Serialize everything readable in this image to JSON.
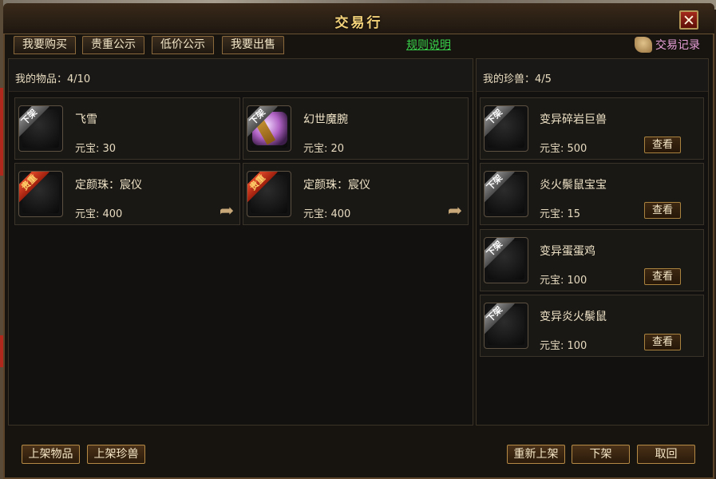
{
  "window": {
    "title": "交易行",
    "close_label": "✕"
  },
  "tabs": [
    {
      "label": "我要购买"
    },
    {
      "label": "贵重公示"
    },
    {
      "label": "低价公示"
    },
    {
      "label": "我要出售"
    }
  ],
  "rules_link": "规则说明",
  "trade_record": "交易记录",
  "items_panel": {
    "label": "我的物品：4/10",
    "items": [
      {
        "badge": "下架",
        "name": "飞雪",
        "price": "元宝: 30"
      },
      {
        "badge": "下架",
        "name": "幻世魔腕",
        "price": "元宝: 20"
      },
      {
        "badge": "贵重",
        "name": "定颜珠：宸仪",
        "price": "元宝: 400"
      },
      {
        "badge": "贵重",
        "name": "定颜珠：宸仪",
        "price": "元宝: 400"
      }
    ]
  },
  "pets_panel": {
    "label": "我的珍兽：4/5",
    "view_label": "查看",
    "pets": [
      {
        "badge": "下架",
        "name": "变异碎岩巨兽",
        "price": "元宝: 500"
      },
      {
        "badge": "下架",
        "name": "炎火鬃鼠宝宝",
        "price": "元宝: 15"
      },
      {
        "badge": "下架",
        "name": "变异蛋蛋鸡",
        "price": "元宝: 100"
      },
      {
        "badge": "下架",
        "name": "变异炎火鬃鼠",
        "price": "元宝: 100"
      }
    ]
  },
  "bottom_buttons": {
    "list_item": "上架物品",
    "list_pet": "上架珍兽",
    "relist": "重新上架",
    "delist": "下架",
    "retrieve": "取回"
  },
  "colors": {
    "accent_gold": "#f3d27a",
    "link_green": "#38d24a",
    "record_pink": "#e8a0d8",
    "badge_red": "#c4321a"
  }
}
